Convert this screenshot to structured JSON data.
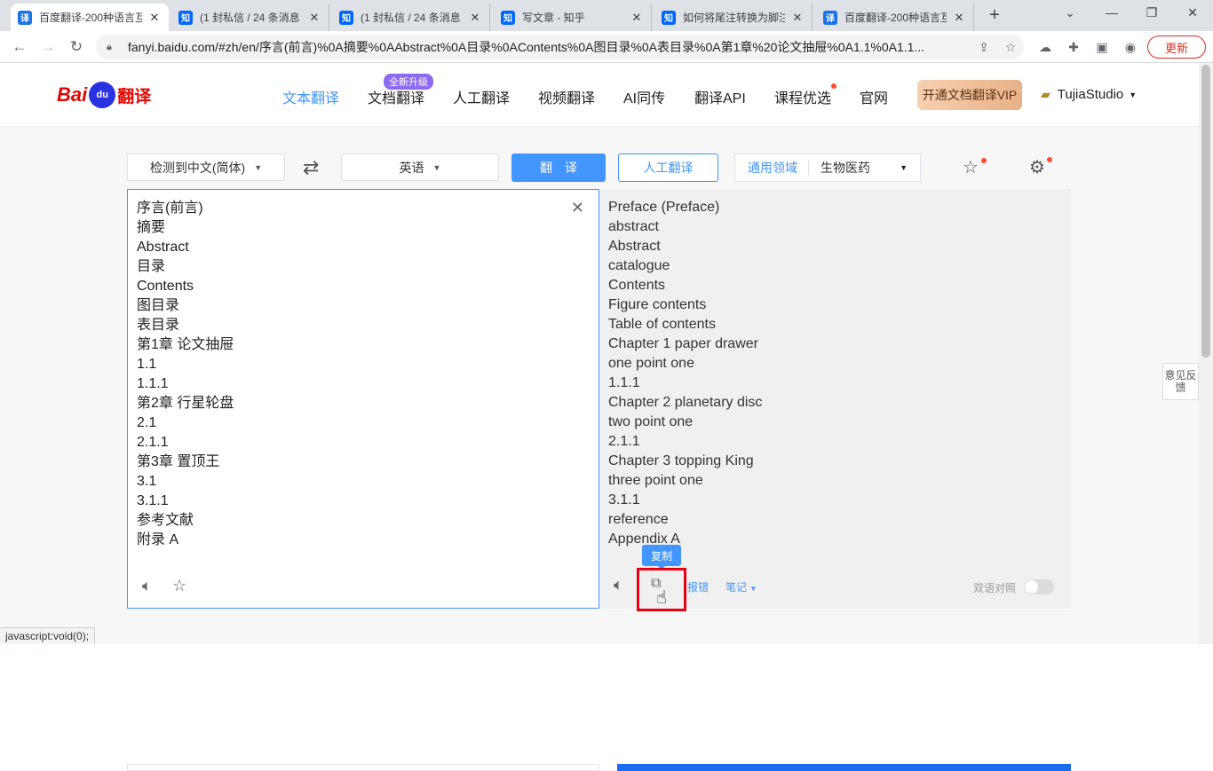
{
  "browser": {
    "tabs": [
      {
        "icon": "译",
        "title": "百度翻译-200种语言互",
        "active": true
      },
      {
        "icon": "知",
        "title": "(1 封私信 / 24 条消息",
        "active": false
      },
      {
        "icon": "知",
        "title": "(1 封私信 / 24 条消息",
        "active": false
      },
      {
        "icon": "知",
        "title": "写文章 - 知乎",
        "active": false
      },
      {
        "icon": "知",
        "title": "如何将尾注转换为脚注",
        "active": false
      },
      {
        "icon": "译",
        "title": "百度翻译-200种语言互",
        "active": false
      }
    ],
    "new_tab": "+",
    "url": "fanyi.baidu.com/#zh/en/序言(前言)%0A摘要%0AAbstract%0A目录%0AContents%0A图目录%0A表目录%0A第1章%20论文抽屉%0A1.1%0A1.1...",
    "update_label": "更新",
    "status_url": "javascript:void(0);"
  },
  "site": {
    "logo": {
      "bai": "Bai",
      "du": "du",
      "fanyi": "翻译"
    },
    "nav": [
      "文本翻译",
      "文档翻译",
      "人工翻译",
      "视频翻译",
      "AI同传",
      "翻译API",
      "课程优选",
      "官网"
    ],
    "new_badge": "全新升级",
    "vip_label": "开通文档翻译VIP",
    "username": "TujiaStudio"
  },
  "controls": {
    "source_lang": "检测到中文(简体)",
    "target_lang": "英语",
    "translate_label": "翻译",
    "human_translate_label": "人工翻译",
    "domain_label": "通用领域",
    "domain_value": "生物医药"
  },
  "source_lines": [
    "序言(前言)",
    "摘要",
    "Abstract",
    "目录",
    "Contents",
    "图目录",
    "表目录",
    "第1章 论文抽屉",
    "1.1",
    "1.1.1",
    "第2章 行星轮盘",
    "2.1",
    "2.1.1",
    "第3章 置顶王",
    "3.1",
    "3.1.1",
    "参考文献",
    "附录 A"
  ],
  "target_lines": [
    "Preface (Preface)",
    "abstract",
    "Abstract",
    "catalogue",
    "Contents",
    "Figure contents",
    "Table of contents",
    "Chapter 1 paper drawer",
    "one point one",
    "1.1.1",
    "Chapter 2 planetary disc",
    "two point one",
    "2.1.1",
    "Chapter 3 topping King",
    "three point one",
    "3.1.1",
    "reference",
    "Appendix A"
  ],
  "result_toolbar": {
    "copy_tooltip": "复制",
    "report_label": "报错",
    "notes_label": "笔记",
    "bilingual_label": "双语对照",
    "bilingual_on": false
  },
  "feedback_label": "意见反馈",
  "colors": {
    "accent": "#4395ff",
    "highlight": "#e60012",
    "brand_red": "#e10601"
  }
}
